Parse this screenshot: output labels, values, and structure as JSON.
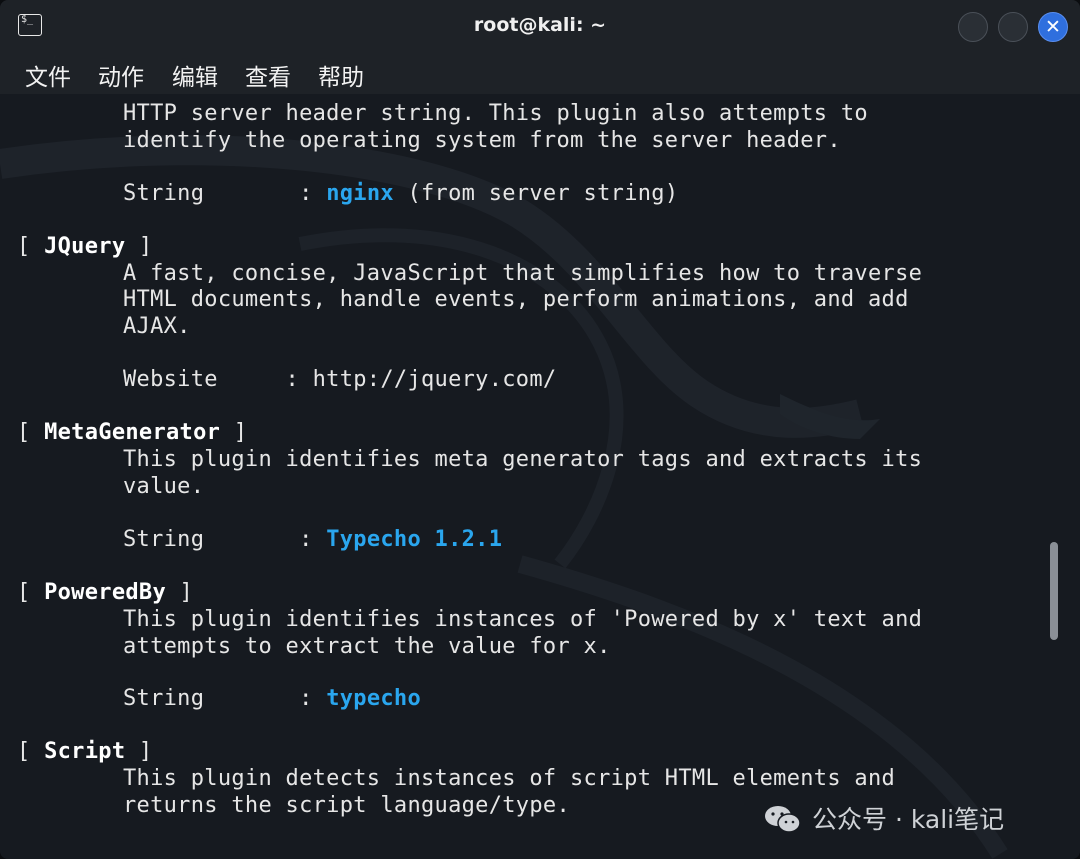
{
  "window": {
    "title": "root@kali: ~",
    "icon": "terminal-icon",
    "close_symbol": "✕"
  },
  "menu": [
    "文件",
    "动作",
    "编辑",
    "查看",
    "帮助"
  ],
  "terminal": {
    "http_desc_1": "HTTP server header string. This plugin also attempts to",
    "http_desc_2": "identify the operating system from the server header.",
    "http_string_label": "String       : ",
    "http_string_value": "nginx",
    "http_string_suffix": " (from server string)",
    "jquery_open": "[ ",
    "jquery_name": "JQuery",
    "jquery_close": " ]",
    "jquery_desc_1": "A fast, concise, JavaScript that simplifies how to traverse",
    "jquery_desc_2": "HTML documents, handle events, perform animations, and add",
    "jquery_desc_3": "AJAX.",
    "jquery_website": "Website     : http://jquery.com/",
    "meta_open": "[ ",
    "meta_name": "MetaGenerator",
    "meta_close": " ]",
    "meta_desc_1": "This plugin identifies meta generator tags and extracts its",
    "meta_desc_2": "value.",
    "meta_string_label": "String       : ",
    "meta_string_value": "Typecho 1.2.1",
    "powered_open": "[ ",
    "powered_name": "PoweredBy",
    "powered_close": " ]",
    "powered_desc_1": "This plugin identifies instances of 'Powered by x' text and",
    "powered_desc_2": "attempts to extract the value for x.",
    "powered_string_label": "String       : ",
    "powered_string_value": "typecho",
    "script_open": "[ ",
    "script_name": "Script",
    "script_close": " ]",
    "script_desc_1": "This plugin detects instances of script HTML elements and",
    "script_desc_2": "returns the script language/type."
  },
  "watermark": {
    "text": "公众号 · kali笔记",
    "icon": "wechat-icon"
  },
  "colors": {
    "highlight": "#2aa6ee",
    "background": "#161a20",
    "close_button": "#2f6fde"
  }
}
